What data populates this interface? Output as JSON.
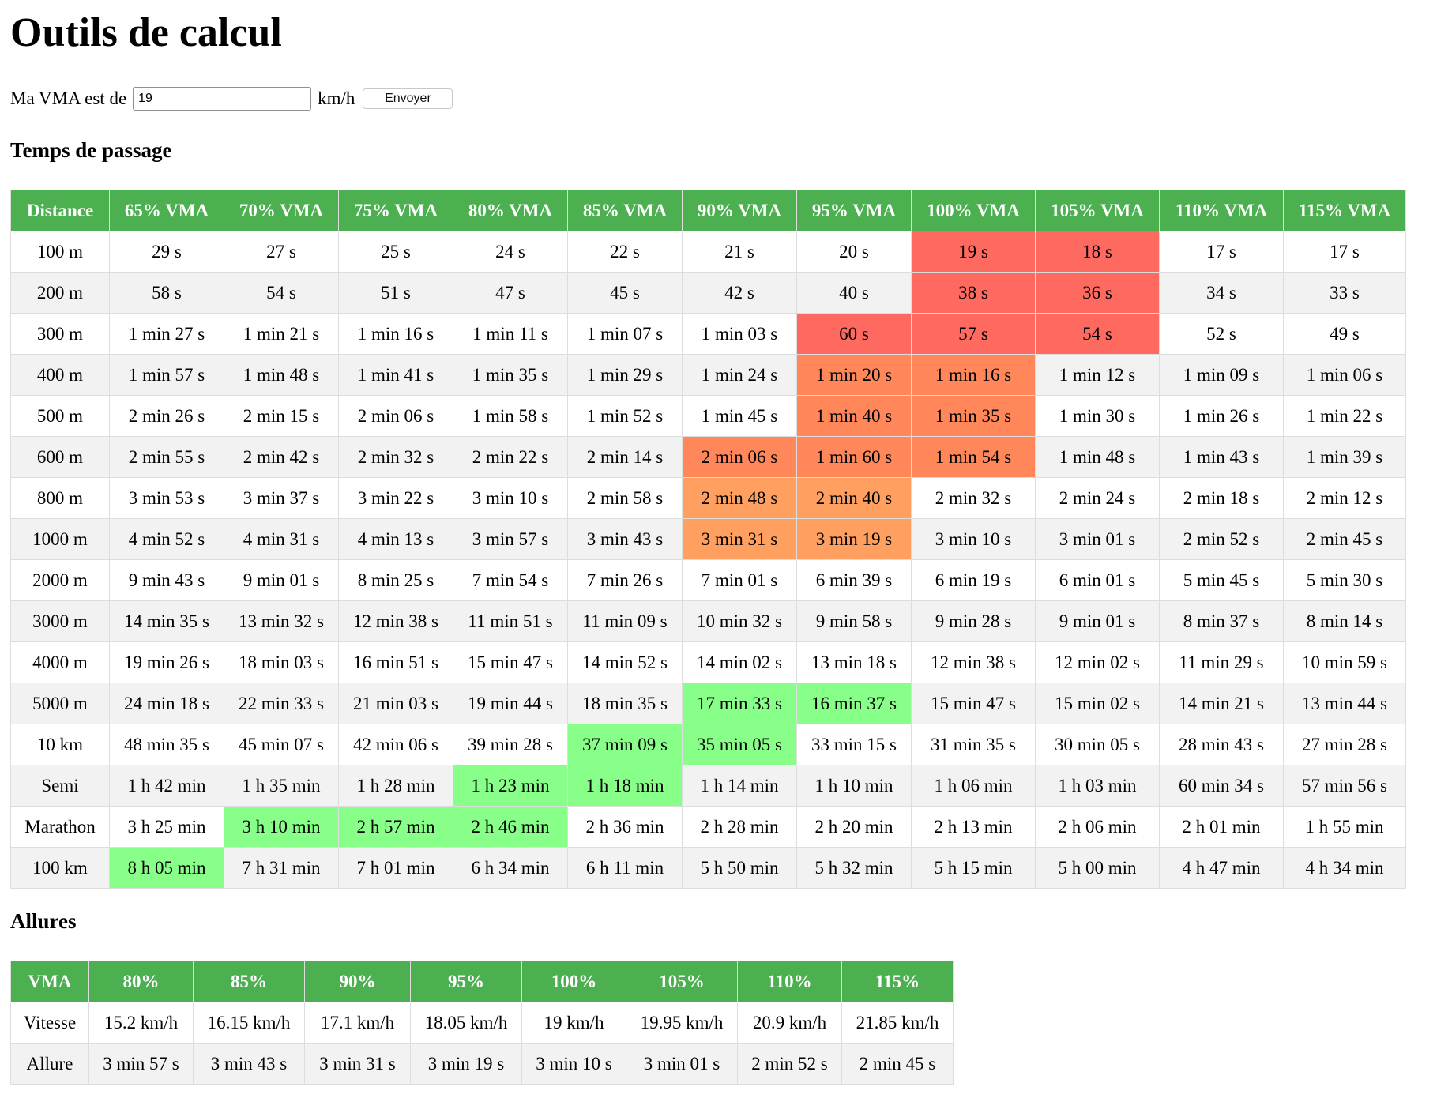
{
  "page_title": "Outils de calcul",
  "form": {
    "label": "Ma VMA est de",
    "value": "19",
    "unit": "km/h",
    "submit_label": "Envoyer"
  },
  "passage": {
    "title": "Temps de passage",
    "headers": [
      "Distance",
      "65% VMA",
      "70% VMA",
      "75% VMA",
      "80% VMA",
      "85% VMA",
      "90% VMA",
      "95% VMA",
      "100% VMA",
      "105% VMA",
      "110% VMA",
      "115% VMA"
    ],
    "rows": [
      [
        "100 m",
        "29 s",
        "27 s",
        "25 s",
        "24 s",
        "22 s",
        "21 s",
        "20 s",
        "19 s",
        "18 s",
        "17 s",
        "17 s"
      ],
      [
        "200 m",
        "58 s",
        "54 s",
        "51 s",
        "47 s",
        "45 s",
        "42 s",
        "40 s",
        "38 s",
        "36 s",
        "34 s",
        "33 s"
      ],
      [
        "300 m",
        "1 min 27 s",
        "1 min 21 s",
        "1 min 16 s",
        "1 min 11 s",
        "1 min 07 s",
        "1 min 03 s",
        "60 s",
        "57 s",
        "54 s",
        "52 s",
        "49 s"
      ],
      [
        "400 m",
        "1 min 57 s",
        "1 min 48 s",
        "1 min 41 s",
        "1 min 35 s",
        "1 min 29 s",
        "1 min 24 s",
        "1 min 20 s",
        "1 min 16 s",
        "1 min 12 s",
        "1 min 09 s",
        "1 min 06 s"
      ],
      [
        "500 m",
        "2 min 26 s",
        "2 min 15 s",
        "2 min 06 s",
        "1 min 58 s",
        "1 min 52 s",
        "1 min 45 s",
        "1 min 40 s",
        "1 min 35 s",
        "1 min 30 s",
        "1 min 26 s",
        "1 min 22 s"
      ],
      [
        "600 m",
        "2 min 55 s",
        "2 min 42 s",
        "2 min 32 s",
        "2 min 22 s",
        "2 min 14 s",
        "2 min 06 s",
        "1 min 60 s",
        "1 min 54 s",
        "1 min 48 s",
        "1 min 43 s",
        "1 min 39 s"
      ],
      [
        "800 m",
        "3 min 53 s",
        "3 min 37 s",
        "3 min 22 s",
        "3 min 10 s",
        "2 min 58 s",
        "2 min 48 s",
        "2 min 40 s",
        "2 min 32 s",
        "2 min 24 s",
        "2 min 18 s",
        "2 min 12 s"
      ],
      [
        "1000 m",
        "4 min 52 s",
        "4 min 31 s",
        "4 min 13 s",
        "3 min 57 s",
        "3 min 43 s",
        "3 min 31 s",
        "3 min 19 s",
        "3 min 10 s",
        "3 min 01 s",
        "2 min 52 s",
        "2 min 45 s"
      ],
      [
        "2000 m",
        "9 min 43 s",
        "9 min 01 s",
        "8 min 25 s",
        "7 min 54 s",
        "7 min 26 s",
        "7 min 01 s",
        "6 min 39 s",
        "6 min 19 s",
        "6 min 01 s",
        "5 min 45 s",
        "5 min 30 s"
      ],
      [
        "3000 m",
        "14 min 35 s",
        "13 min 32 s",
        "12 min 38 s",
        "11 min 51 s",
        "11 min 09 s",
        "10 min 32 s",
        "9 min 58 s",
        "9 min 28 s",
        "9 min 01 s",
        "8 min 37 s",
        "8 min 14 s"
      ],
      [
        "4000 m",
        "19 min 26 s",
        "18 min 03 s",
        "16 min 51 s",
        "15 min 47 s",
        "14 min 52 s",
        "14 min 02 s",
        "13 min 18 s",
        "12 min 38 s",
        "12 min 02 s",
        "11 min 29 s",
        "10 min 59 s"
      ],
      [
        "5000 m",
        "24 min 18 s",
        "22 min 33 s",
        "21 min 03 s",
        "19 min 44 s",
        "18 min 35 s",
        "17 min 33 s",
        "16 min 37 s",
        "15 min 47 s",
        "15 min 02 s",
        "14 min 21 s",
        "13 min 44 s"
      ],
      [
        "10 km",
        "48 min 35 s",
        "45 min 07 s",
        "42 min 06 s",
        "39 min 28 s",
        "37 min 09 s",
        "35 min 05 s",
        "33 min 15 s",
        "31 min 35 s",
        "30 min 05 s",
        "28 min 43 s",
        "27 min 28 s"
      ],
      [
        "Semi",
        "1 h 42 min",
        "1 h 35 min",
        "1 h 28 min",
        "1 h 23 min",
        "1 h 18 min",
        "1 h 14 min",
        "1 h 10 min",
        "1 h 06 min",
        "1 h 03 min",
        "60 min 34 s",
        "57 min 56 s"
      ],
      [
        "Marathon",
        "3 h 25 min",
        "3 h 10 min",
        "2 h 57 min",
        "2 h 46 min",
        "2 h 36 min",
        "2 h 28 min",
        "2 h 20 min",
        "2 h 13 min",
        "2 h 06 min",
        "2 h 01 min",
        "1 h 55 min"
      ],
      [
        "100 km",
        "8 h 05 min",
        "7 h 31 min",
        "7 h 01 min",
        "6 h 34 min",
        "6 h 11 min",
        "5 h 50 min",
        "5 h 32 min",
        "5 h 15 min",
        "5 h 00 min",
        "4 h 47 min",
        "4 h 34 min"
      ]
    ],
    "highlights": [
      {
        "row": 0,
        "col": 8,
        "color": "#ff6a60"
      },
      {
        "row": 0,
        "col": 9,
        "color": "#ff6a60"
      },
      {
        "row": 1,
        "col": 8,
        "color": "#ff6a60"
      },
      {
        "row": 1,
        "col": 9,
        "color": "#ff6a60"
      },
      {
        "row": 2,
        "col": 7,
        "color": "#ff6a60"
      },
      {
        "row": 2,
        "col": 8,
        "color": "#ff6a60"
      },
      {
        "row": 2,
        "col": 9,
        "color": "#ff6a60"
      },
      {
        "row": 3,
        "col": 7,
        "color": "#ff875a"
      },
      {
        "row": 3,
        "col": 8,
        "color": "#ff875a"
      },
      {
        "row": 4,
        "col": 7,
        "color": "#ff875a"
      },
      {
        "row": 4,
        "col": 8,
        "color": "#ff875a"
      },
      {
        "row": 5,
        "col": 6,
        "color": "#ff875a"
      },
      {
        "row": 5,
        "col": 7,
        "color": "#ff875a"
      },
      {
        "row": 5,
        "col": 8,
        "color": "#ff875a"
      },
      {
        "row": 6,
        "col": 6,
        "color": "#ffa060"
      },
      {
        "row": 6,
        "col": 7,
        "color": "#ffa060"
      },
      {
        "row": 7,
        "col": 6,
        "color": "#ffa060"
      },
      {
        "row": 7,
        "col": 7,
        "color": "#ffa060"
      },
      {
        "row": 11,
        "col": 6,
        "color": "#88ff88"
      },
      {
        "row": 11,
        "col": 7,
        "color": "#88ff88"
      },
      {
        "row": 12,
        "col": 5,
        "color": "#88ff88"
      },
      {
        "row": 12,
        "col": 6,
        "color": "#88ff88"
      },
      {
        "row": 13,
        "col": 4,
        "color": "#88ff88"
      },
      {
        "row": 13,
        "col": 5,
        "color": "#88ff88"
      },
      {
        "row": 14,
        "col": 2,
        "color": "#88ff88"
      },
      {
        "row": 14,
        "col": 3,
        "color": "#88ff88"
      },
      {
        "row": 14,
        "col": 4,
        "color": "#88ff88"
      },
      {
        "row": 15,
        "col": 1,
        "color": "#88ff88"
      }
    ]
  },
  "allures": {
    "title": "Allures",
    "headers": [
      "VMA",
      "80%",
      "85%",
      "90%",
      "95%",
      "100%",
      "105%",
      "110%",
      "115%"
    ],
    "rows": [
      [
        "Vitesse",
        "15.2 km/h",
        "16.15 km/h",
        "17.1 km/h",
        "18.05 km/h",
        "19 km/h",
        "19.95 km/h",
        "20.9 km/h",
        "21.85 km/h"
      ],
      [
        "Allure",
        "3 min 57 s",
        "3 min 43 s",
        "3 min 31 s",
        "3 min 19 s",
        "3 min 10 s",
        "3 min 01 s",
        "2 min 52 s",
        "2 min 45 s"
      ]
    ]
  },
  "colors": {
    "header_bg": "#4caf50",
    "stripe_bg": "#f2f2f2",
    "border": "#dddddd"
  }
}
